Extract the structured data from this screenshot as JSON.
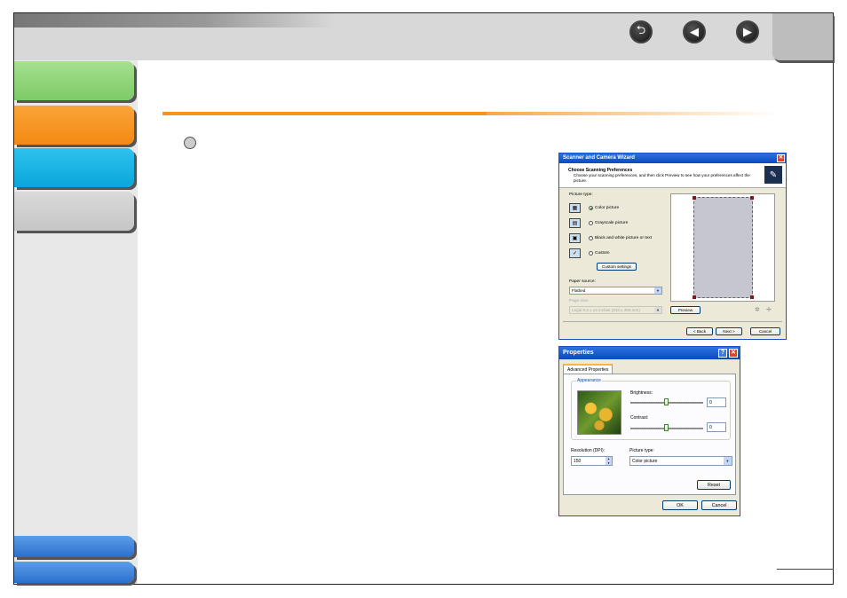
{
  "nav": {
    "back_icon": "back-arrow-icon",
    "prev_icon": "previous-icon",
    "next_icon": "next-icon",
    "back_glyph": "⮌",
    "prev_glyph": "◀",
    "next_glyph": "▶"
  },
  "colors": {
    "tab_green": "#8fd67e",
    "tab_orange": "#f7941d",
    "tab_cyan": "#16b3e6",
    "tab_gray": "#cfcfcf",
    "rule_orange": "#f7941d"
  },
  "scanner_wizard": {
    "title": "Scanner and Camera Wizard",
    "close_glyph": "✕",
    "header_title": "Choose Scanning Preferences",
    "header_desc": "Choose your scanning preferences, and then click Preview to see how your preferences affect the picture.",
    "picture_type_label": "Picture type:",
    "options": [
      {
        "label": "Color picture",
        "selected": true
      },
      {
        "label": "Grayscale picture",
        "selected": false
      },
      {
        "label": "Black and white picture or text",
        "selected": false
      },
      {
        "label": "Custom",
        "selected": false
      }
    ],
    "custom_settings_label": "Custom settings",
    "paper_source_label": "Paper source:",
    "paper_source_value": "Flatbed",
    "page_size_label": "Page size:",
    "page_size_value": "Legal 8.5 x 14 inches (216 x 356 mm)",
    "preview_label": "Preview",
    "back_label": "< Back",
    "next_label": "Next >",
    "cancel_label": "Cancel"
  },
  "properties": {
    "title": "Properties",
    "help_glyph": "?",
    "close_glyph": "✕",
    "tab_label": "Advanced Properties",
    "appearance_label": "Appearance",
    "brightness_label": "Brightness:",
    "brightness_value": "0",
    "contrast_label": "Contrast:",
    "contrast_value": "0",
    "resolution_label": "Resolution (DPI):",
    "resolution_value": "150",
    "picture_type_label": "Picture type:",
    "picture_type_value": "Color picture",
    "reset_label": "Reset",
    "ok_label": "OK",
    "cancel_label": "Cancel"
  }
}
